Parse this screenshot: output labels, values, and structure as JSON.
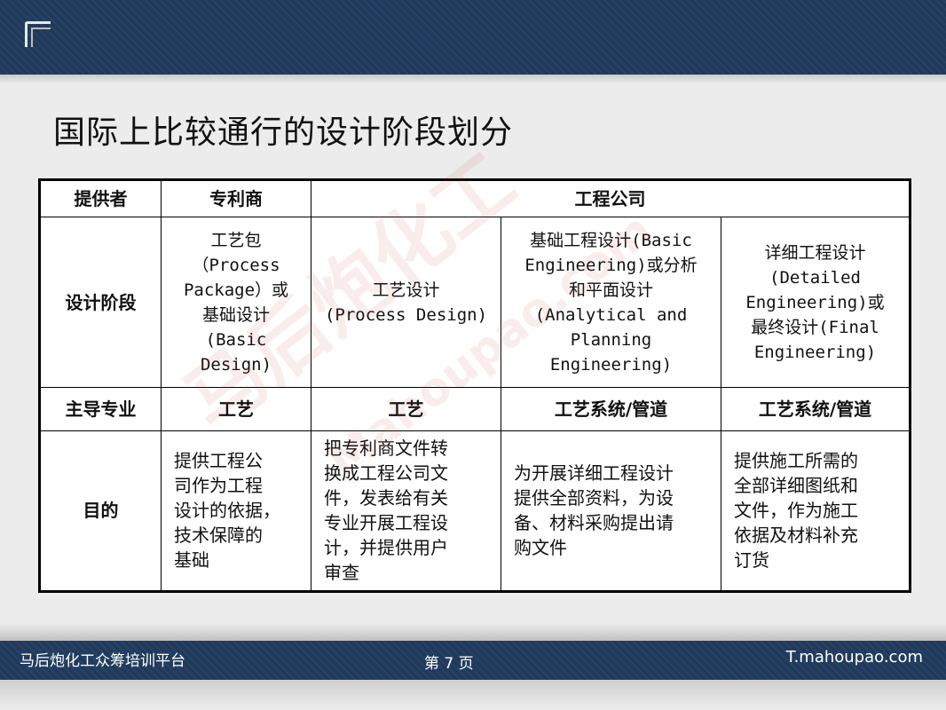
{
  "slide": {
    "title": "国际上比较通行的设计阶段划分"
  },
  "table": {
    "header": [
      "提供者",
      "专利商",
      "工程公司"
    ],
    "stage": {
      "label": "设计阶段",
      "cells": [
        "工艺包\n（Process\nPackage）或\n基础设计\n(Basic\nDesign)",
        "工艺设计\n(Process Design)",
        "基础工程设计(Basic\nEngineering)或分析\n和平面设计\n(Analytical and\nPlanning\nEngineering)",
        "详细工程设计\n(Detailed\nEngineering)或\n最终设计(Final\nEngineering)"
      ]
    },
    "major": {
      "label": "主导专业",
      "cells": [
        "工艺",
        "工艺",
        "工艺系统/管道",
        "工艺系统/管道"
      ]
    },
    "purpose": {
      "label": "目的",
      "cells": [
        "提供工程公\n司作为工程\n设计的依据，\n技术保障的\n基础",
        "把专利商文件转\n换成工程公司文\n件，发表给有关\n专业开展工程设\n计，并提供用户\n审查",
        "为开展详细工程设计\n提供全部资料，为设\n备、材料采购提出请\n购文件",
        "提供施工所需的\n全部详细图纸和\n文件，作为施工\n依据及材料补充\n订货"
      ]
    }
  },
  "watermark": {
    "text_cn": "马后炮化工",
    "text_en": "Mahoupao.com"
  },
  "footer": {
    "left": "马后炮化工众筹培训平台",
    "center": "第 7 页",
    "right": "T.mahoupao.com"
  }
}
